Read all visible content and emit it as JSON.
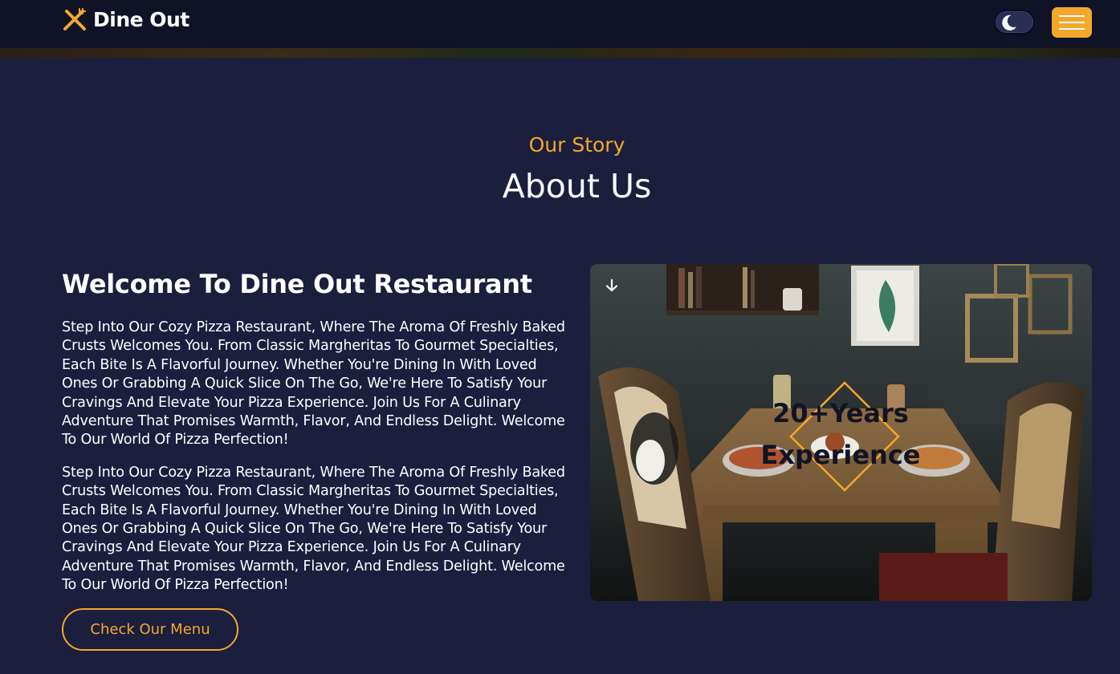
{
  "brand": {
    "name": "Dine Out",
    "icon": "fork-knife-icon",
    "accent": "#f3a82b"
  },
  "header": {
    "theme_toggle_icon": "moon-icon",
    "menu_icon": "hamburger-icon"
  },
  "section": {
    "eyebrow": "Our Story",
    "title": "About Us"
  },
  "about": {
    "heading": "Welcome To Dine Out Restaurant",
    "paragraphs": [
      "Step Into Our Cozy Pizza Restaurant, Where The Aroma Of Freshly Baked Crusts Welcomes You. From Classic Margheritas To Gourmet Specialties, Each Bite Is A Flavorful Journey. Whether You're Dining In With Loved Ones Or Grabbing A Quick Slice On The Go, We're Here To Satisfy Your Cravings And Elevate Your Pizza Experience. Join Us For A Culinary Adventure That Promises Warmth, Flavor, And Endless Delight. Welcome To Our World Of Pizza Perfection!",
      "Step Into Our Cozy Pizza Restaurant, Where The Aroma Of Freshly Baked Crusts Welcomes You. From Classic Margheritas To Gourmet Specialties, Each Bite Is A Flavorful Journey. Whether You're Dining In With Loved Ones Or Grabbing A Quick Slice On The Go, We're Here To Satisfy Your Cravings And Elevate Your Pizza Experience. Join Us For A Culinary Adventure That Promises Warmth, Flavor, And Endless Delight. Welcome To Our World Of Pizza Perfection!"
    ],
    "cta_label": "Check Our Menu"
  },
  "experience_badge": {
    "line1": "20+Years",
    "line2": "Experience"
  },
  "colors": {
    "background": "#1b1e3d",
    "header": "#101326",
    "accent": "#f3a82b",
    "text": "#ffffff"
  }
}
